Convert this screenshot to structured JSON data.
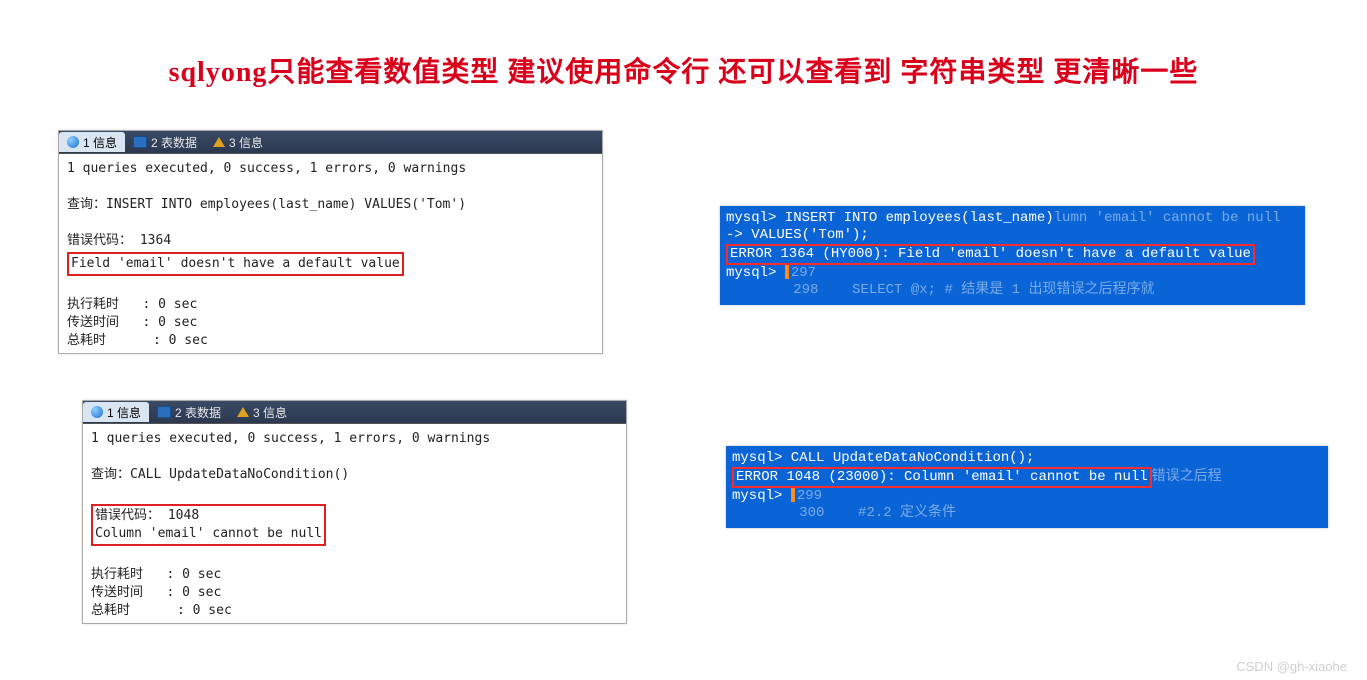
{
  "title": "sqlyong只能查看数值类型 建议使用命令行 还可以查看到 字符串类型 更清晰一些",
  "tabs": {
    "t1": "1 信息",
    "t2": "2 表数据",
    "t3": "3 信息"
  },
  "panel1": {
    "summary": "1 queries executed, 0 success, 1 errors, 0 warnings",
    "query_label": "查询：",
    "query": "INSERT INTO employees(last_name) VALUES('Tom')",
    "errcode_label": "错误代码：",
    "errcode": "1364",
    "errmsg": "Field 'email' doesn't have a default value",
    "t_exec_l": "执行耗时",
    "t_exec_v": ": 0 sec",
    "t_send_l": "传送时间",
    "t_send_v": ": 0 sec",
    "t_total_l": "总耗时",
    "t_total_v": ": 0 sec"
  },
  "panel2": {
    "summary": "1 queries executed, 0 success, 1 errors, 0 warnings",
    "query_label": "查询：",
    "query": "CALL UpdateDataNoCondition()",
    "errcode_label": "错误代码：",
    "errcode": "1048",
    "errmsg": "Column 'email' cannot be null",
    "t_exec_l": "执行耗时",
    "t_exec_v": ": 0 sec",
    "t_send_l": "传送时间",
    "t_send_v": ": 0 sec",
    "t_total_l": "总耗时",
    "t_total_v": ": 0 sec"
  },
  "cli1": {
    "l1": "mysql> INSERT INTO employees(last_name)",
    "ghost1a": "lumn 'email' cannot be null",
    "l2": "    -> VALUES('Tom');",
    "err": "ERROR 1364 (HY000): Field 'email' doesn't have a default value",
    "prompt": "mysql>",
    "g297": "297",
    "g298a": "298",
    "g298b": "SELECT @x; # 结果是 1 出现错误之后程序就"
  },
  "cli2": {
    "l1": "mysql> CALL UpdateDataNoCondition();",
    "err": "ERROR 1048 (23000): Column 'email' cannot be null",
    "ghost_tail": "错误之后程",
    "prompt": "mysql>",
    "g299": "299",
    "g300a": "300",
    "g300b": "#2.2 定义条件"
  },
  "watermark": "CSDN @gh-xiaohe"
}
